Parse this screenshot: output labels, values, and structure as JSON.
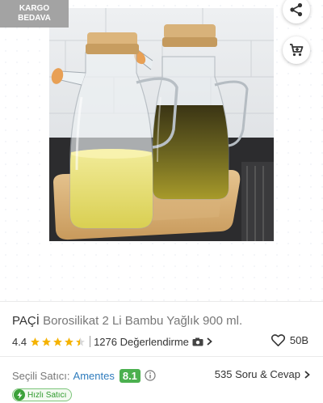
{
  "badge": {
    "cargo_line1": "KARGO",
    "cargo_line2": "BEDAVA"
  },
  "actions": {
    "share_icon": "share-icon",
    "cart_icon": "cart-icon"
  },
  "product": {
    "brand": "PAÇİ",
    "name": "Borosilikat 2 Li Bambu Yağlık 900 ml.",
    "rating": "4.4",
    "rating_value": 4.4,
    "review_count": "1276 Değerlendirme",
    "favorites": "50B"
  },
  "seller": {
    "label": "Seçili Satıcı:",
    "name": "Amentes",
    "score": "8.1",
    "qa": "535 Soru & Cevap",
    "fast_seller": "Hızlı Satıcı"
  },
  "colors": {
    "accent_orange": "#f28c1c",
    "link_blue": "#2f7cbd",
    "score_green": "#4bb04f",
    "star_yellow": "#f5b301"
  }
}
